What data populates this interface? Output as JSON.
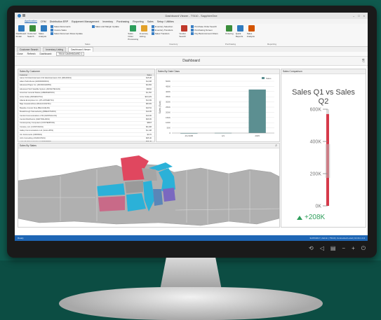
{
  "app": {
    "title": "Dashboard Viewer - TSI10 - SapphireOne",
    "window_controls": [
      "–",
      "□",
      "×"
    ]
  },
  "menu": {
    "items": [
      "Application",
      "CRM",
      "Distribution ERP",
      "Equipment Management",
      "Inventory",
      "Purchasing",
      "Reporting",
      "Sales",
      "Setup / Utilities"
    ],
    "active": "Application"
  },
  "ribbon": {
    "buttons": [
      {
        "label": "Dashboard Finder",
        "icon": "dashboard-icon",
        "color": "#2f7bbf"
      },
      {
        "label": "Customer Search",
        "icon": "customer-icon",
        "color": "#3b8e3b"
      },
      {
        "label": "Sales Analysis",
        "icon": "sales-icon",
        "color": "#2f7bbf"
      }
    ],
    "list1": [
      "Sales Documents",
      "Invoice Sales",
      "Sales Document Rows Update"
    ],
    "list1b": [
      "Sales and Margin Update"
    ],
    "sales_caption": "Sales",
    "buttons2": [
      {
        "label": "Sales Order Processing",
        "icon": "order-icon",
        "color": "#2e9e5b"
      },
      {
        "label": "Inventory Listing",
        "icon": "inventory-icon",
        "color": "#e2a12a"
      }
    ],
    "list2": [
      "Inventory Selection",
      "Inventory Transfers",
      "Sales Transfers"
    ],
    "inventory_caption": "Inventory",
    "buttons3": [
      {
        "label": "Vendor Search",
        "icon": "vendor-icon",
        "color": "#c0392b"
      }
    ],
    "list3": [
      "Purchase Order Search",
      "Purchasing Screen",
      "Pay Bank Account Filters"
    ],
    "purchasing_caption": "Purchasing",
    "buttons4": [
      {
        "label": "Ordering",
        "icon": "ordering-icon",
        "color": "#3b8e3b"
      },
      {
        "label": "Quick Reports",
        "icon": "reports-icon",
        "color": "#2f7bbf"
      },
      {
        "label": "Sales Analysis",
        "icon": "analysis-icon",
        "color": "#d35400"
      }
    ],
    "reporting_caption": "Reporting"
  },
  "tabs": [
    {
      "label": "Customer Search",
      "selected": false
    },
    {
      "label": "Inventory Listing",
      "selected": false
    },
    {
      "label": "Dashboard Viewer",
      "selected": true
    }
  ],
  "toolstrip": [
    "Close",
    "Refresh",
    "Dashboard:",
    "TSI10 DASHBOARD 1"
  ],
  "dashboard": {
    "title": "Dashboard"
  },
  "customers_panel": {
    "title": "Sales By Customer",
    "col_customer": "Customer",
    "col_sales": "Sales",
    "rows": [
      {
        "name": "Aaron Fitz Electrical Aaron Fitz Electrical Aaron Fitz (ABA00001)",
        "sales": "$15.08"
      },
      {
        "name": "Adam Parfa Renat (AD0000000001)",
        "sales": "$1,038"
      },
      {
        "name": "Advanced Paper Co. (ADVANCEDP01)",
        "sales": "$2,084"
      },
      {
        "name": "Advanced Tech Satellite System (ADVANTECH01)",
        "sales": "$6092"
      },
      {
        "name": "American General Skates (AMERGENS01)",
        "sales": "$1,152"
      },
      {
        "name": "Annie Sutka (ANNIESUTKA)",
        "sales": "$16,029"
      },
      {
        "name": "Atlanta Enterprises Inc. (ATLANTAENT01)",
        "sales": "$1,049"
      },
      {
        "name": "Baja Coastal Airlines (BAJACOAST01)",
        "sales": "$8,539"
      },
      {
        "name": "Beaulieu Investo Sina (BEAULIEU01)",
        "sales": "$40.54"
      },
      {
        "name": "Breakthrough Telemarketing (BREAKTHR01)",
        "sales": "$10.95"
      },
      {
        "name": "Central Communications LTD (CENTRALC01)",
        "sales": "$10.06"
      },
      {
        "name": "Central Distributors (CENTRALD001)",
        "sales": "$06.65"
      },
      {
        "name": "Contemporary Computers (CONTEMPO01)",
        "sales": "$68.8"
      },
      {
        "name": "Contoso, Ltd. (CONTOSO01)",
        "sales": "$6,208"
      },
      {
        "name": "Gallup Communications Ltd. (GALLUP01)",
        "sales": "$1,148"
      },
      {
        "name": "Jim Instruments (JIMINS01)",
        "sales": "$0.76"
      },
      {
        "name": "John Consulting (JOHNCON01)",
        "sales": "$65.46"
      },
      {
        "name": "Lakeside Telemarketing (LAKESIDE01)",
        "sales": "$55.45"
      }
    ]
  },
  "chart_panel": {
    "title": "Sales By Date Class"
  },
  "chart_data": {
    "type": "bar",
    "categories": [
      "4/1/1995",
      "4/1",
      "2005"
    ],
    "values": [
      400,
      2000,
      420000
    ],
    "ylabel": "Sales (Sum)",
    "yticks": [
      "0",
      "50K",
      "100K",
      "150K",
      "200K",
      "250K",
      "300K",
      "350K",
      "400K",
      "450K",
      "500K"
    ],
    "ylim": [
      0,
      500000
    ],
    "legend": "Sales",
    "legend_placement": "top-right",
    "grid": true,
    "bar_color": "#5c8f91"
  },
  "kpi_panel": {
    "title": "Sales Comparison",
    "heading": "Sales Q1 vs Sales Q2",
    "ticks": [
      "600K",
      "400K",
      "200K",
      "0K"
    ],
    "value": "+208K",
    "delta_fraction": 0.35,
    "accent": "#d63a4a",
    "up_color": "#2e9e5b"
  },
  "map_panel": {
    "title": "Sales By States",
    "highlight_colors": [
      "#e0475f",
      "#2bb1d8",
      "#5a86b8",
      "#c86a88",
      "#7a68c0"
    ]
  },
  "statusbar": {
    "left": "Ready",
    "right": "31/05/2017 | Admin | TSI10 | Connected Local | 10.34.1.3.4"
  },
  "osd": [
    "⟲",
    "◁",
    "▤",
    "−",
    "+",
    "⏻"
  ]
}
